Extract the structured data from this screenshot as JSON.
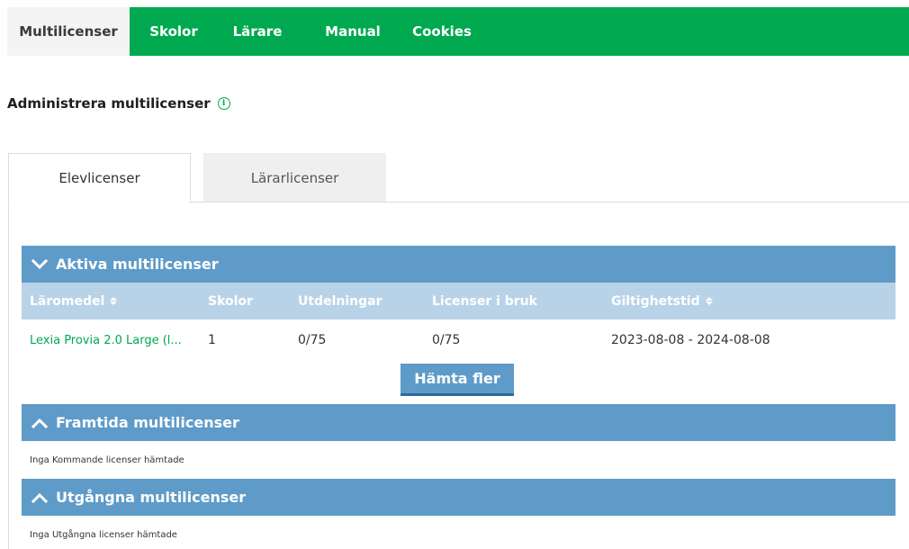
{
  "nav": {
    "items": [
      {
        "label": "Multilicenser",
        "active": true
      },
      {
        "label": "Skolor"
      },
      {
        "label": "Lärare"
      },
      {
        "label": "Manual"
      },
      {
        "label": "Cookies"
      }
    ]
  },
  "page": {
    "title": "Administrera multilicenser",
    "info_icon": "i"
  },
  "tabs": [
    {
      "label": "Elevlicenser",
      "active": true
    },
    {
      "label": "Lärarlicenser",
      "active": false
    }
  ],
  "sections": {
    "active": {
      "title": "Aktiva multilicenser",
      "columns": [
        "Läromedel",
        "Skolor",
        "Utdelningar",
        "Licenser i bruk",
        "Giltighetstid"
      ],
      "rows": [
        {
          "laromedel": "Lexia Provia 2.0 Large (l...",
          "skolor": "1",
          "utdelningar": "0/75",
          "licenser": "0/75",
          "giltighetstid": "2023-08-08 - 2024-08-08"
        }
      ],
      "fetch_button": "Hämta fler"
    },
    "future": {
      "title": "Framtida multilicenser",
      "empty": "Inga Kommande licenser hämtade"
    },
    "expired": {
      "title": "Utgångna multilicenser",
      "empty": "Inga Utgångna licenser hämtade"
    }
  },
  "colors": {
    "nav_green": "#00a94f",
    "section_blue": "#5e9bc8",
    "column_header_blue": "#b8d3e8",
    "link_green": "#00a94f"
  }
}
